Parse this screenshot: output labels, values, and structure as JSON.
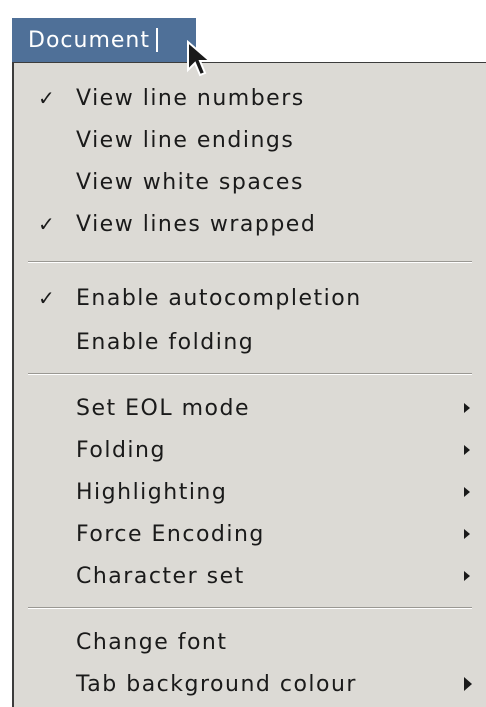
{
  "menubar": {
    "title": "Document"
  },
  "menu": {
    "items": [
      {
        "label": "View line numbers",
        "checked": true
      },
      {
        "label": "View line endings",
        "checked": false
      },
      {
        "label": "View white spaces",
        "checked": false
      },
      {
        "label": "View lines wrapped",
        "checked": true
      },
      {
        "label": "Enable autocompletion",
        "checked": true
      },
      {
        "label": "Enable folding",
        "checked": false
      },
      {
        "label": "Set EOL mode",
        "submenu": true
      },
      {
        "label": "Folding",
        "submenu": true
      },
      {
        "label": "Highlighting",
        "submenu": true
      },
      {
        "label": "Force Encoding",
        "submenu": true
      },
      {
        "label": "Character set",
        "submenu": true
      },
      {
        "label": "Change font",
        "submenu": false
      },
      {
        "label": "Tab background colour",
        "submenu": true
      }
    ],
    "check_glyph": "✓"
  },
  "colors": {
    "menubar_bg": "#4f7098",
    "menu_bg": "#dcdad5",
    "text": "#1a1a1a"
  },
  "icons": {
    "pointer": "mouse-pointer-icon",
    "check": "check-icon",
    "submenu": "submenu-arrow-icon"
  }
}
